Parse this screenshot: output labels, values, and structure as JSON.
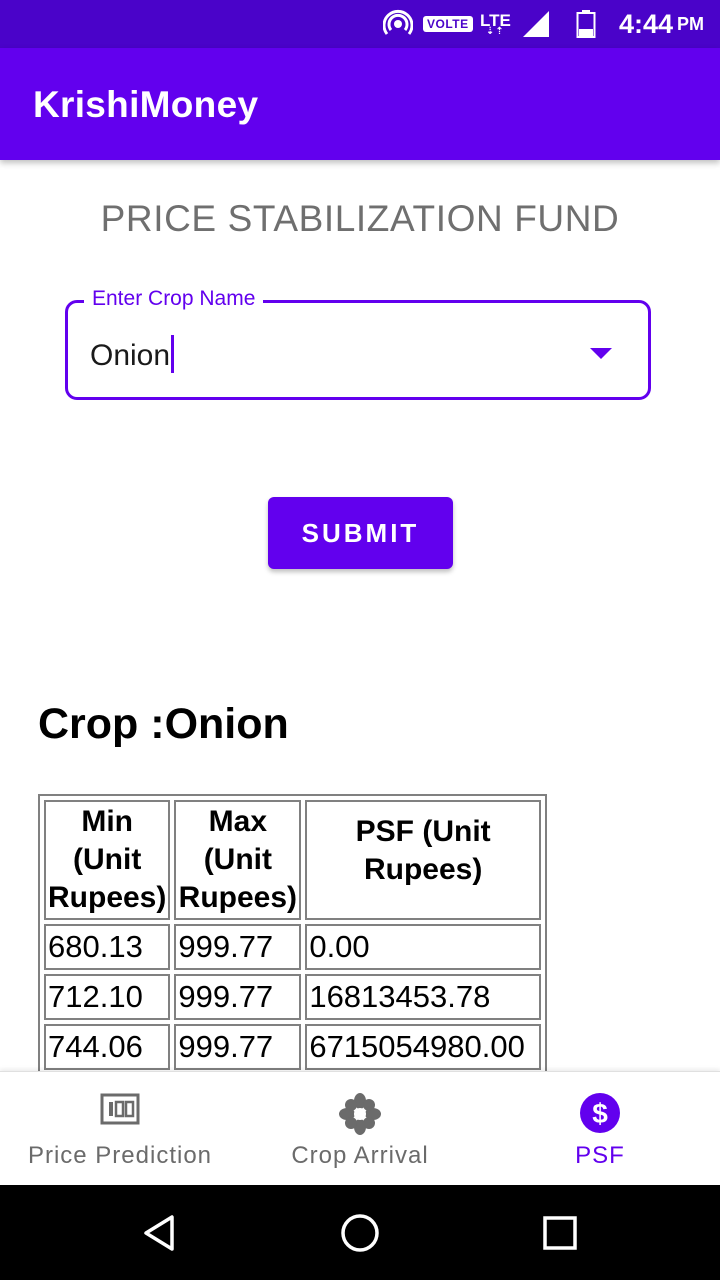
{
  "status_bar": {
    "volte": "VOLTE",
    "network": "LTE",
    "time": "4:44",
    "ampm": "PM"
  },
  "app": {
    "title": "KrishiMoney"
  },
  "page_title": "PRICE STABILIZATION FUND",
  "crop_field": {
    "label": "Enter Crop Name",
    "value": "Onion"
  },
  "submit_label": "SUBMIT",
  "result_heading": "Crop :Onion",
  "table": {
    "headers": [
      "Min (Unit Rupees)",
      "Max (Unit Rupees)",
      "PSF (Unit Rupees)"
    ],
    "rows": [
      [
        "680.13",
        "999.77",
        "0.00"
      ],
      [
        "712.10",
        "999.77",
        "16813453.78"
      ],
      [
        "744.06",
        "999.77",
        "6715054980.00"
      ]
    ]
  },
  "bottom_nav": {
    "items": [
      {
        "label": "Price Prediction",
        "icon": "counter-icon",
        "active": false
      },
      {
        "label": "Crop Arrival",
        "icon": "flower-icon",
        "active": false
      },
      {
        "label": "PSF",
        "icon": "dollar-icon",
        "active": true
      }
    ]
  },
  "colors": {
    "primary": "#6200ee",
    "status_bar": "#4a03c9",
    "inactive": "#6b6b6b"
  }
}
